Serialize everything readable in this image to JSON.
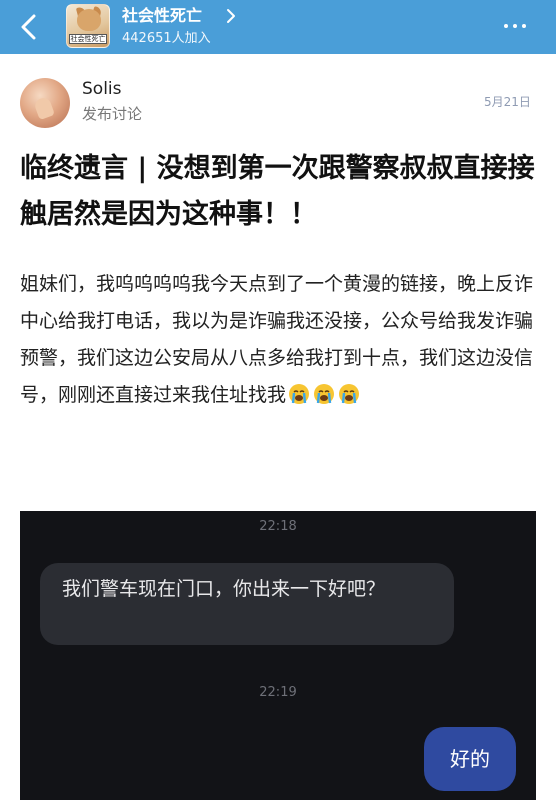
{
  "header": {
    "group_name": "社会性死亡",
    "member_count": "442651人加入",
    "avatar_caption": "社会性死亡",
    "accent_color": "#4a9ed8"
  },
  "post": {
    "author_name": "Solis",
    "author_action": "发布讨论",
    "date": "5月21日",
    "title": "临终遗言 | 没想到第一次跟警察叔叔直接接触居然是因为这种事！！",
    "body": "姐妹们，我呜呜呜呜我今天点到了一个黄漫的链接，晚上反诈中心给我打电话，我以为是诈骗我还没接，公众号给我发诈骗预警，我们这边公安局从八点多给我打到十点，我们这边没信号，刚刚还直接过来我住址找我",
    "body_emojis": [
      "crying-face-icon",
      "crying-face-icon",
      "crying-face-icon"
    ]
  },
  "chat_screenshot": {
    "time_1": "22:18",
    "incoming_message": "我们警车现在门口，你出来一下好吧？",
    "time_2": "22:19",
    "outgoing_message": "好的",
    "background_color": "#121317",
    "outgoing_bubble_color": "#2f4aa0"
  }
}
